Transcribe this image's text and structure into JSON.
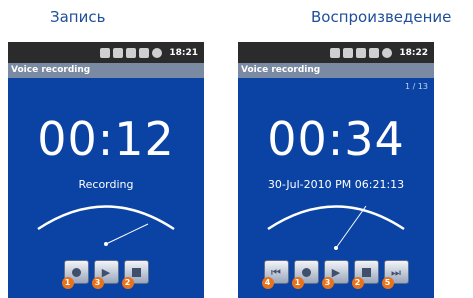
{
  "captions": {
    "left": "Запись",
    "right": "Воспроизведение"
  },
  "screens": {
    "record": {
      "status_time": "18:21",
      "app_title": "Voice recording",
      "timer": "00:12",
      "status_text": "Recording",
      "buttons": [
        {
          "icon": "record-icon",
          "badge": "1"
        },
        {
          "icon": "play-icon",
          "badge": "3"
        },
        {
          "icon": "stop-icon",
          "badge": "2"
        }
      ]
    },
    "playback": {
      "status_time": "18:22",
      "app_title": "Voice recording",
      "counter": "1 / 13",
      "timer": "00:34",
      "datetime": "30-Jul-2010 PM 06:21:13",
      "buttons": [
        {
          "icon": "previous-icon",
          "badge": "4"
        },
        {
          "icon": "record-icon",
          "badge": "1"
        },
        {
          "icon": "play-icon",
          "badge": "3"
        },
        {
          "icon": "stop-icon",
          "badge": "2"
        },
        {
          "icon": "next-icon",
          "badge": "5"
        }
      ]
    }
  },
  "colors": {
    "screen_bg": "#0a43a4",
    "badge": "#e8731c",
    "caption": "#1f4e9a"
  }
}
